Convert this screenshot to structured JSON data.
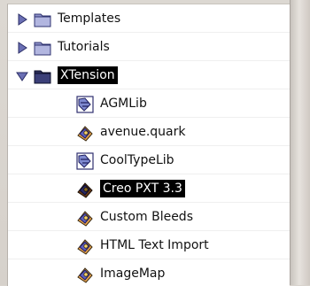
{
  "items": [
    {
      "label": "Templates",
      "type": "folder",
      "state": "collapsed",
      "selected": false
    },
    {
      "label": "Tutorials",
      "type": "folder",
      "state": "collapsed",
      "selected": false
    },
    {
      "label": "XTension",
      "type": "folder",
      "state": "expanded",
      "selected": true
    },
    {
      "label": "AGMLib",
      "type": "library",
      "selected": false
    },
    {
      "label": "avenue.quark",
      "type": "xtension",
      "selected": false
    },
    {
      "label": "CoolTypeLib",
      "type": "library",
      "selected": false
    },
    {
      "label": "Creo PXT 3.3",
      "type": "xtension",
      "selected": true
    },
    {
      "label": "Custom Bleeds",
      "type": "xtension",
      "selected": false
    },
    {
      "label": "HTML Text Import",
      "type": "xtension",
      "selected": false
    },
    {
      "label": "ImageMap",
      "type": "xtension",
      "selected": false
    }
  ]
}
